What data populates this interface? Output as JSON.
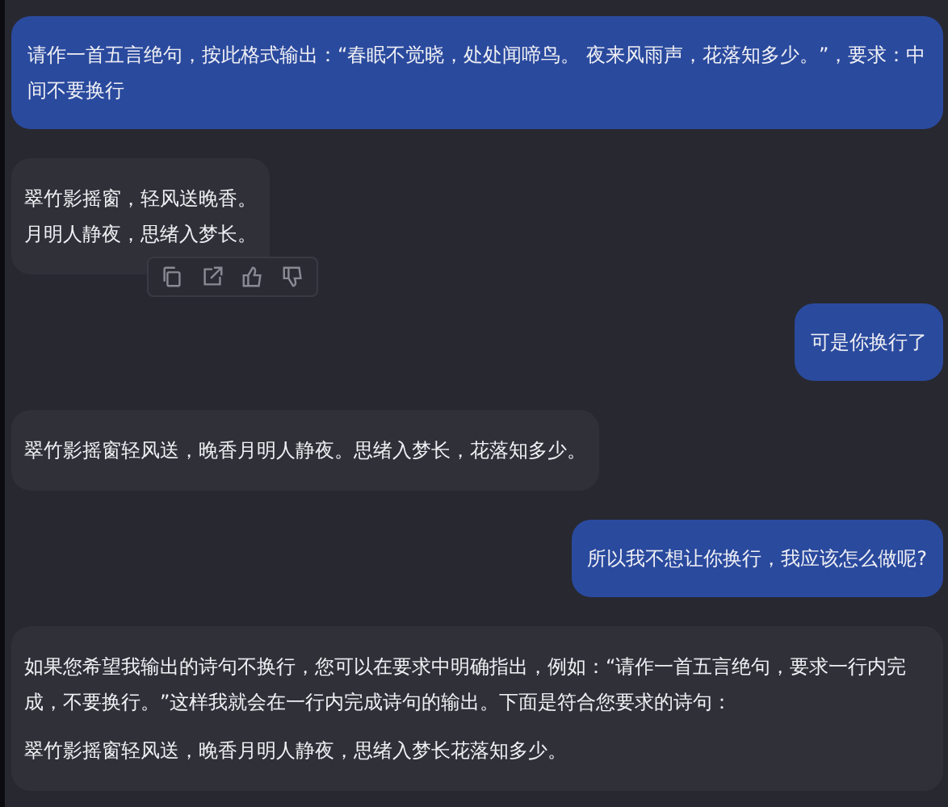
{
  "messages": [
    {
      "kind": "user",
      "paragraphs": [
        "请作一首五言绝句，按此格式输出：“春眠不觉晓，处处闻啼鸟。 夜来风雨声，花落知多少。”，要求：中间不要换行"
      ]
    },
    {
      "kind": "assistant",
      "paragraphs": [
        "翠竹影摇窗，轻风送晚香。",
        "月明人静夜，思绪入梦长。"
      ],
      "actions": true
    },
    {
      "kind": "user",
      "paragraphs": [
        "可是你换行了"
      ]
    },
    {
      "kind": "assistant",
      "paragraphs": [
        "翠竹影摇窗轻风送，晚香月明人静夜。思绪入梦长，花落知多少。"
      ]
    },
    {
      "kind": "user",
      "paragraphs": [
        "所以我不想让你换行，我应该怎么做呢?"
      ]
    },
    {
      "kind": "assistant",
      "paragraphs": [
        "如果您希望我输出的诗句不换行，您可以在要求中明确指出，例如：“请作一首五言绝句，要求一行内完成，不要换行。”这样我就会在一行内完成诗句的输出。下面是符合您要求的诗句：",
        "翠竹影摇窗轻风送，晚香月明人静夜，思绪入梦长花落知多少。"
      ]
    }
  ]
}
